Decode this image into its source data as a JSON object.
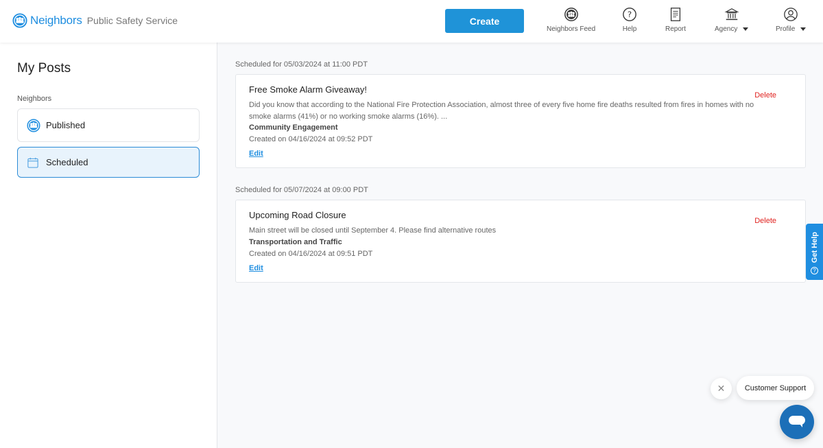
{
  "header": {
    "brand": "Neighbors",
    "subtitle": "Public Safety Service",
    "create_label": "Create",
    "nav": [
      {
        "label": "Neighbors Feed",
        "icon": "neighbors-feed-icon"
      },
      {
        "label": "Help",
        "icon": "help-icon"
      },
      {
        "label": "Report",
        "icon": "report-icon"
      },
      {
        "label": "Agency",
        "icon": "agency-icon",
        "dropdown": true
      },
      {
        "label": "Profile",
        "icon": "profile-icon",
        "dropdown": true
      }
    ]
  },
  "sidebar": {
    "title": "My Posts",
    "section": "Neighbors",
    "items": [
      {
        "label": "Published",
        "icon": "neighbors-icon",
        "active": false
      },
      {
        "label": "Scheduled",
        "icon": "calendar-icon",
        "active": true
      }
    ]
  },
  "posts": [
    {
      "scheduled": "Scheduled for 05/03/2024 at 11:00 PDT",
      "title": "Free Smoke Alarm Giveaway!",
      "body": "Did you know that according to the National Fire Protection Association, almost three of every five home fire deaths resulted from fires in homes with no smoke alarms (41%) or no working smoke alarms (16%). ...",
      "category": "Community Engagement",
      "created": "Created on 04/16/2024 at 09:52 PDT",
      "edit_label": "Edit",
      "delete_label": "Delete"
    },
    {
      "scheduled": "Scheduled for 05/07/2024 at 09:00 PDT",
      "title": "Upcoming Road Closure",
      "body": "Main street will be closed until September 4. Please find alternative routes",
      "category": "Transportation and Traffic",
      "created": "Created on 04/16/2024 at 09:51 PDT",
      "edit_label": "Edit",
      "delete_label": "Delete"
    }
  ],
  "get_help": {
    "label": "Get Help",
    "icon_glyph": "?"
  },
  "chat": {
    "close_glyph": "✕",
    "bubble_label": "Customer Support"
  },
  "colors": {
    "brand": "#1f8ee0",
    "delete": "#e0221f",
    "active_bg": "#e8f3fc"
  }
}
